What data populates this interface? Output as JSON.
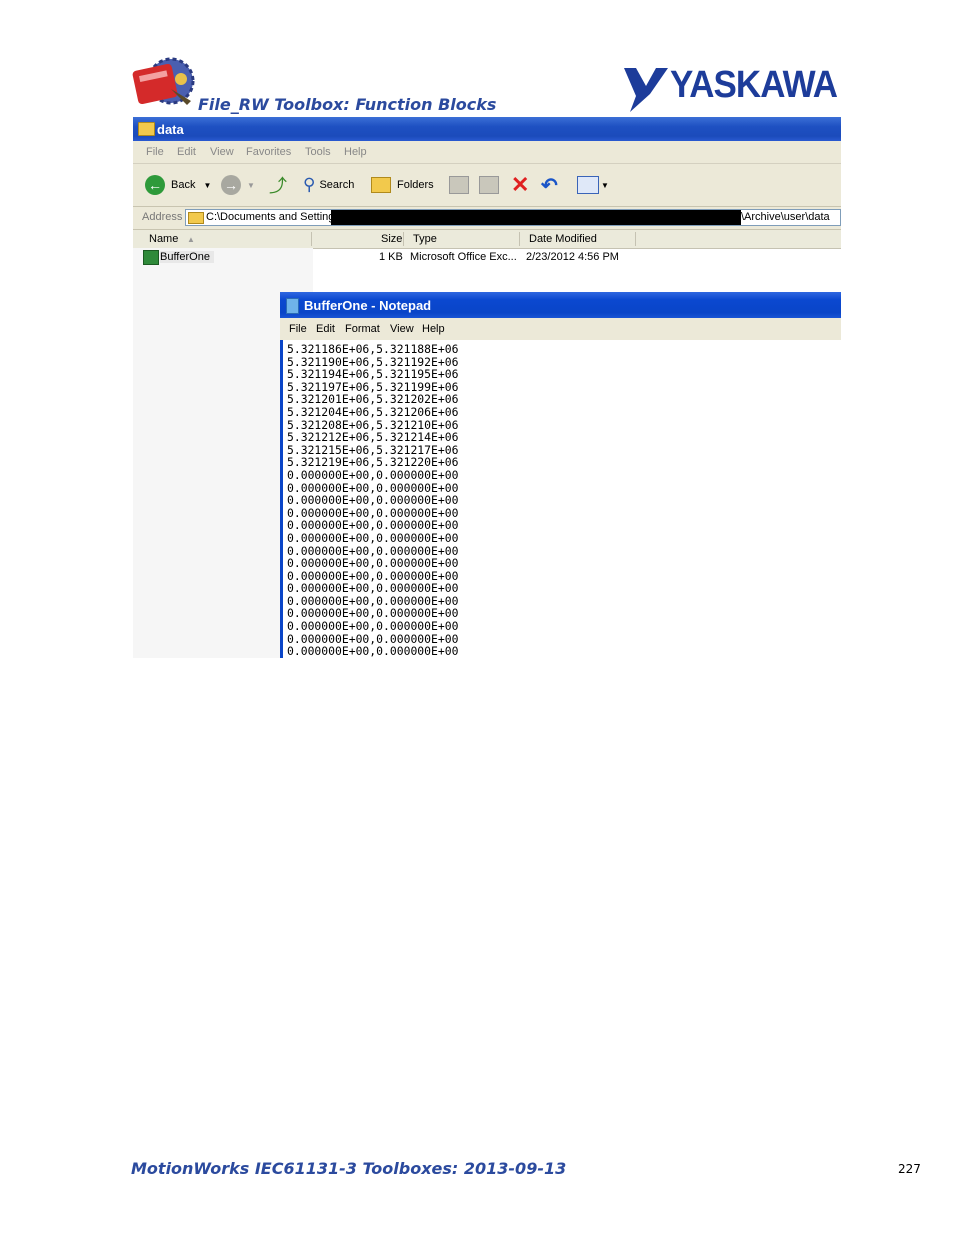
{
  "header": {
    "title": "File_RW Toolbox: Function Blocks",
    "brand": "YASKAWA",
    "brand_color": "#1d3c9a"
  },
  "explorer": {
    "window_title": "data",
    "menu": [
      "File",
      "Edit",
      "View",
      "Favorites",
      "Tools",
      "Help"
    ],
    "toolbar": {
      "back_label": "Back",
      "search_label": "Search",
      "folders_label": "Folders"
    },
    "address": {
      "label": "Address",
      "path_start": "C:\\Documents and Settings",
      "path_end": "\\Archive\\user\\data"
    },
    "columns": [
      "Name",
      "Size",
      "Type",
      "Date Modified"
    ],
    "files": [
      {
        "name": "BufferOne",
        "size": "1 KB",
        "type": "Microsoft Office Exc...",
        "modified": "2/23/2012 4:56 PM"
      }
    ]
  },
  "notepad": {
    "window_title": "BufferOne - Notepad",
    "menu": [
      "File",
      "Edit",
      "Format",
      "View",
      "Help"
    ],
    "content": "5.321186E+06,5.321188E+06\n5.321190E+06,5.321192E+06\n5.321194E+06,5.321195E+06\n5.321197E+06,5.321199E+06\n5.321201E+06,5.321202E+06\n5.321204E+06,5.321206E+06\n5.321208E+06,5.321210E+06\n5.321212E+06,5.321214E+06\n5.321215E+06,5.321217E+06\n5.321219E+06,5.321220E+06\n0.000000E+00,0.000000E+00\n0.000000E+00,0.000000E+00\n0.000000E+00,0.000000E+00\n0.000000E+00,0.000000E+00\n0.000000E+00,0.000000E+00\n0.000000E+00,0.000000E+00\n0.000000E+00,0.000000E+00\n0.000000E+00,0.000000E+00\n0.000000E+00,0.000000E+00\n0.000000E+00,0.000000E+00\n0.000000E+00,0.000000E+00\n0.000000E+00,0.000000E+00\n0.000000E+00,0.000000E+00\n0.000000E+00,0.000000E+00\n0.000000E+00,0.000000E+00"
  },
  "footer": {
    "title": "MotionWorks IEC61131-3 Toolboxes: 2013-09-13",
    "page_number": "227"
  }
}
